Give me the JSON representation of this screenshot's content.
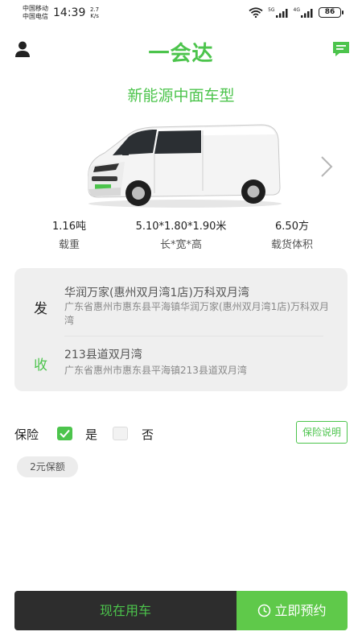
{
  "status_bar": {
    "carrier_1": "中国移动",
    "carrier_2": "中国电信",
    "time": "14:39",
    "net_speed_value": "2.7",
    "net_speed_unit": "K/s",
    "net_label_1": "5G",
    "net_label_2": "4G",
    "battery": "86",
    "icons": [
      "wifi-icon",
      "signal-icon",
      "signal-icon",
      "battery-icon"
    ]
  },
  "header": {
    "title": "一会达",
    "left_icon": "user-icon",
    "right_icon": "message-icon"
  },
  "vehicle": {
    "title": "新能源中面车型",
    "image": "van-image",
    "next_icon": "chevron-right-icon",
    "specs": [
      {
        "value": "1.16吨",
        "label": "载重"
      },
      {
        "value": "5.10*1.80*1.90米",
        "label": "长*宽*高"
      },
      {
        "value": "6.50方",
        "label": "载货体积"
      }
    ]
  },
  "route": {
    "from": {
      "tag": "发",
      "name": "华润万家(惠州双月湾1店)万科双月湾",
      "detail": "广东省惠州市惠东县平海镇华润万家(惠州双月湾1店)万科双月湾"
    },
    "to": {
      "tag": "收",
      "name": "213县道双月湾",
      "detail": "广东省惠州市惠东县平海镇213县道双月湾"
    }
  },
  "insurance": {
    "label": "保险",
    "yes_label": "是",
    "no_label": "否",
    "selected": "是",
    "info_button": "保险说明",
    "amount_chip": "2元保额"
  },
  "actions": {
    "now_button": "现在用车",
    "book_button": "立即预约",
    "book_icon": "clock-icon"
  },
  "colors": {
    "accent": "#4cc44c",
    "dark_button": "#2d2d2d",
    "book_button": "#5fc94a",
    "card_bg": "#efefef"
  }
}
